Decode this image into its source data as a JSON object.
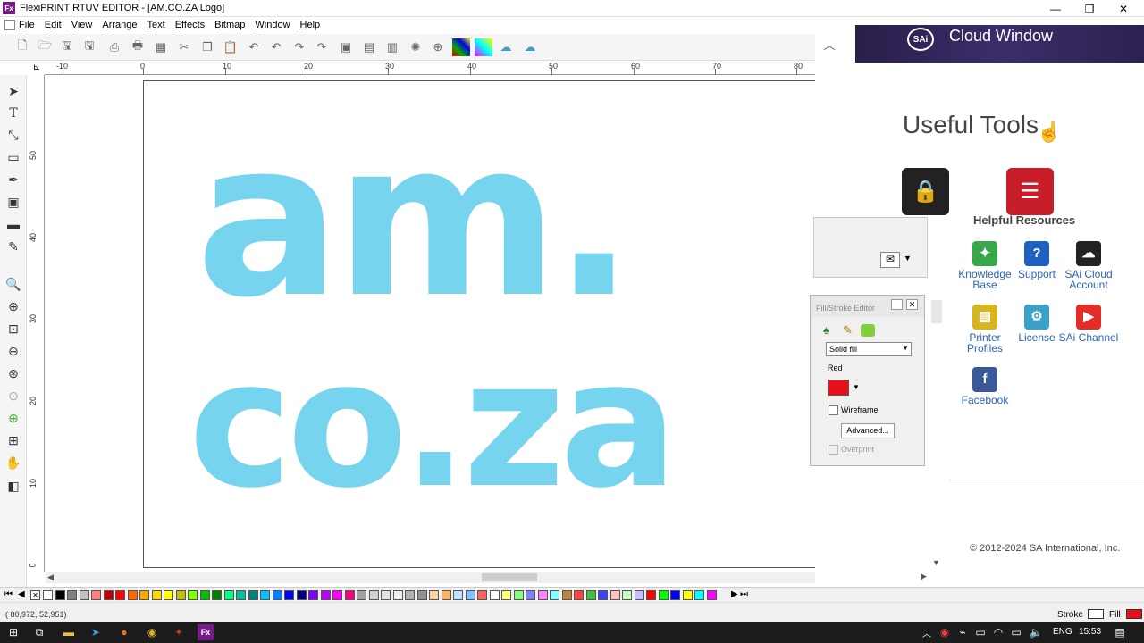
{
  "window": {
    "app_badge": "Fx",
    "title": "FlexiPRINT RTUV EDITOR - [AM.CO.ZA Logo]",
    "min_glyph": "—",
    "max_glyph": "❐",
    "close_glyph": "✕"
  },
  "menu": {
    "items": [
      "File",
      "Edit",
      "View",
      "Arrange",
      "Text",
      "Effects",
      "Bitmap",
      "Window",
      "Help"
    ]
  },
  "ruler": {
    "top_labels": [
      "-10",
      "0",
      "10",
      "20",
      "30",
      "40",
      "50",
      "60",
      "70",
      "80"
    ],
    "left_labels": [
      "50",
      "40",
      "30",
      "20",
      "10",
      "0"
    ]
  },
  "document": {
    "logo_line1": "am.",
    "logo_line2": "co.za",
    "logo_color": "#76d4ef"
  },
  "side_panel": {
    "cloud_window_title": "Cloud Window",
    "useful_tools_heading": "Useful Tools",
    "helpful_resources_heading": "Helpful Resources",
    "resources": [
      {
        "label": "Knowledge Base",
        "icon": "lightbulb-icon",
        "color": "#37a84a"
      },
      {
        "label": "Support",
        "icon": "question-icon",
        "color": "#1f5fbf"
      },
      {
        "label": "SAi Cloud Account",
        "icon": "cloud-icon",
        "color": "#222222"
      },
      {
        "label": "Printer Profiles",
        "icon": "printer-profile-icon",
        "color": "#d6b51f"
      },
      {
        "label": "License",
        "icon": "gear-icon",
        "color": "#3aa0c8"
      },
      {
        "label": "SAi Channel",
        "icon": "youtube-icon",
        "color": "#e52d27"
      },
      {
        "label": "Facebook",
        "icon": "facebook-icon",
        "color": "#3b5998"
      }
    ],
    "copyright": "© 2012-2024 SA International, Inc."
  },
  "fill_stroke_editor": {
    "title": "Fill/Stroke Editor",
    "fill_type": "Solid fill",
    "color_name": "Red",
    "color_value": "#e8101a",
    "wireframe_label": "Wireframe",
    "advanced_label": "Advanced...",
    "overprint_label": "Overprint"
  },
  "status": {
    "coords": "( 80,972,  52,951)",
    "stroke_label": "Stroke",
    "fill_label": "Fill",
    "fill_color": "#e8101a"
  },
  "taskbar": {
    "language": "ENG",
    "time": "15:53"
  },
  "palette_colors": [
    "#ffffff",
    "#000000",
    "#808080",
    "#c0c0c0",
    "#ff8080",
    "#c00000",
    "#ff0000",
    "#ff6600",
    "#ffa500",
    "#ffd700",
    "#ffff00",
    "#c0c000",
    "#80ff00",
    "#00c000",
    "#008000",
    "#00ff80",
    "#00c0a0",
    "#008080",
    "#00c0ff",
    "#0080ff",
    "#0000ff",
    "#000080",
    "#8000ff",
    "#c000ff",
    "#ff00ff",
    "#ff0080",
    "#a0a0a0",
    "#d0d0d0",
    "#e0e0e0",
    "#f0f0f0",
    "#b0b0b0",
    "#909090",
    "#ffd0a0",
    "#ffb060",
    "#c0e0ff",
    "#80c0ff",
    "#ff6060",
    "#ffffff",
    "#ffff80",
    "#80ff80",
    "#8080ff",
    "#ff80ff",
    "#80ffff",
    "#c08040",
    "#ff4040",
    "#40c040",
    "#4040ff",
    "#ffc0c0",
    "#c0ffc0",
    "#c0c0ff",
    "#ff0000",
    "#00ff00",
    "#0000ff",
    "#ffff00",
    "#00ffff",
    "#ff00ff"
  ]
}
